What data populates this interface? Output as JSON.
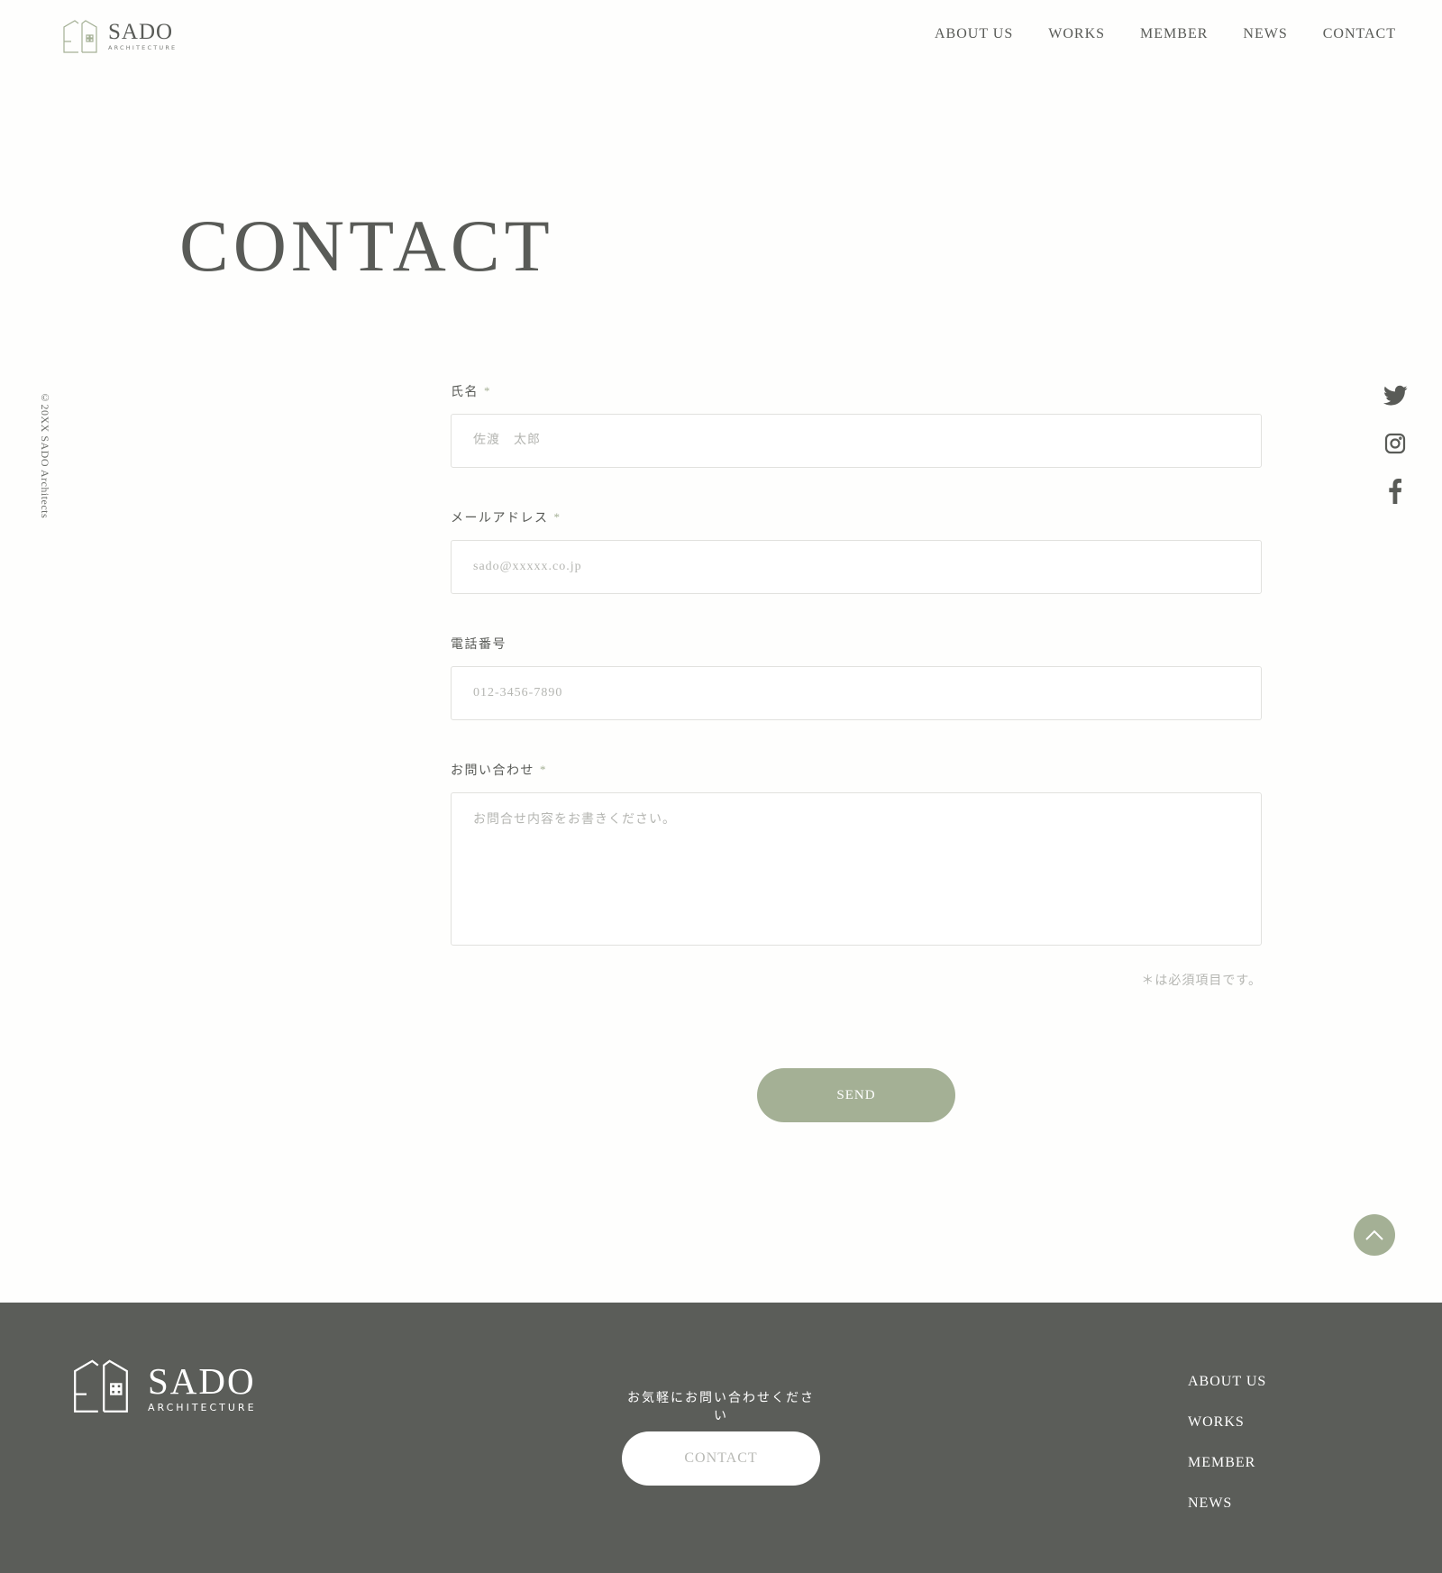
{
  "header": {
    "logo": {
      "name": "SADO",
      "sub": "ARCHITECTURE"
    },
    "nav": [
      "ABOUT US",
      "WORKS",
      "MEMBER",
      "NEWS",
      "CONTACT"
    ]
  },
  "page_title": "CONTACT",
  "copyright": "©20XX SADO Architects",
  "social": {
    "icons": [
      "twitter-icon",
      "instagram-icon",
      "facebook-icon"
    ]
  },
  "form": {
    "required_mark": "*",
    "fields": [
      {
        "label": "氏名",
        "required": true,
        "placeholder": "佐渡　太郎"
      },
      {
        "label": "メールアドレス",
        "required": true,
        "placeholder": "sado@xxxxx.co.jp"
      },
      {
        "label": "電話番号",
        "required": false,
        "placeholder": "012-3456-7890"
      },
      {
        "label": "お問い合わせ",
        "required": true,
        "placeholder": "お問合せ内容をお書きください。"
      }
    ],
    "note": "＊は必須項目です。",
    "send_label": "SEND"
  },
  "colors": {
    "accent": "#a4b095",
    "text": "#595b57",
    "footer_bg": "#5b5d59"
  },
  "footer": {
    "logo": {
      "name": "SADO",
      "sub": "ARCHITECTURE"
    },
    "cta_text": "お気軽にお問い合わせください",
    "cta_button": "CONTACT",
    "nav": [
      "ABOUT US",
      "WORKS",
      "MEMBER",
      "NEWS"
    ]
  }
}
